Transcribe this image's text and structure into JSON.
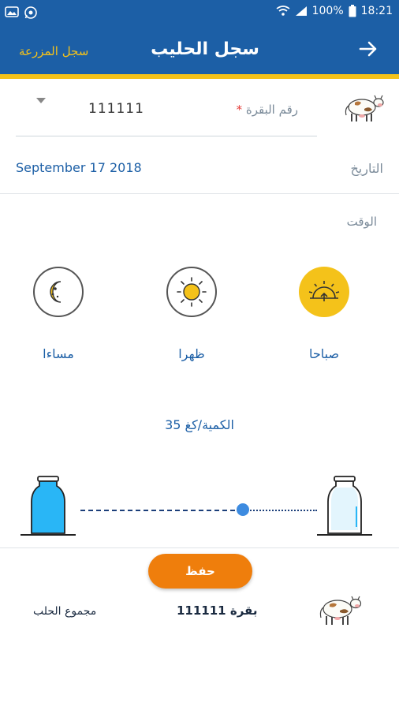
{
  "status_bar": {
    "battery": "100%",
    "time": "18:21"
  },
  "app_bar": {
    "title": "سجل الحليب",
    "farm_link": "سجل المزرعة"
  },
  "form": {
    "cow_number_label": "رقم البقرة",
    "required_mark": "*",
    "cow_number_value": "111111",
    "date_label": "التاريخ",
    "date_value": "September 17 2018",
    "time_label": "الوقت"
  },
  "periods": [
    {
      "label": "صباحا",
      "icon": "sunrise-icon",
      "selected": true
    },
    {
      "label": "ظهرا",
      "icon": "sun-icon",
      "selected": false
    },
    {
      "label": "مساءا",
      "icon": "moon-icon",
      "selected": false
    }
  ],
  "quantity": {
    "label": "35 الكمية/كغ",
    "value": 35
  },
  "save_button": "حفظ",
  "summary": {
    "cow_label": "بقرة 111111",
    "total_label": "مجموع الحلب"
  },
  "colors": {
    "primary": "#1c5fa6",
    "accent_yellow": "#f4c21a",
    "button_orange": "#ef7e0c",
    "milk_blue": "#29b6f6"
  }
}
